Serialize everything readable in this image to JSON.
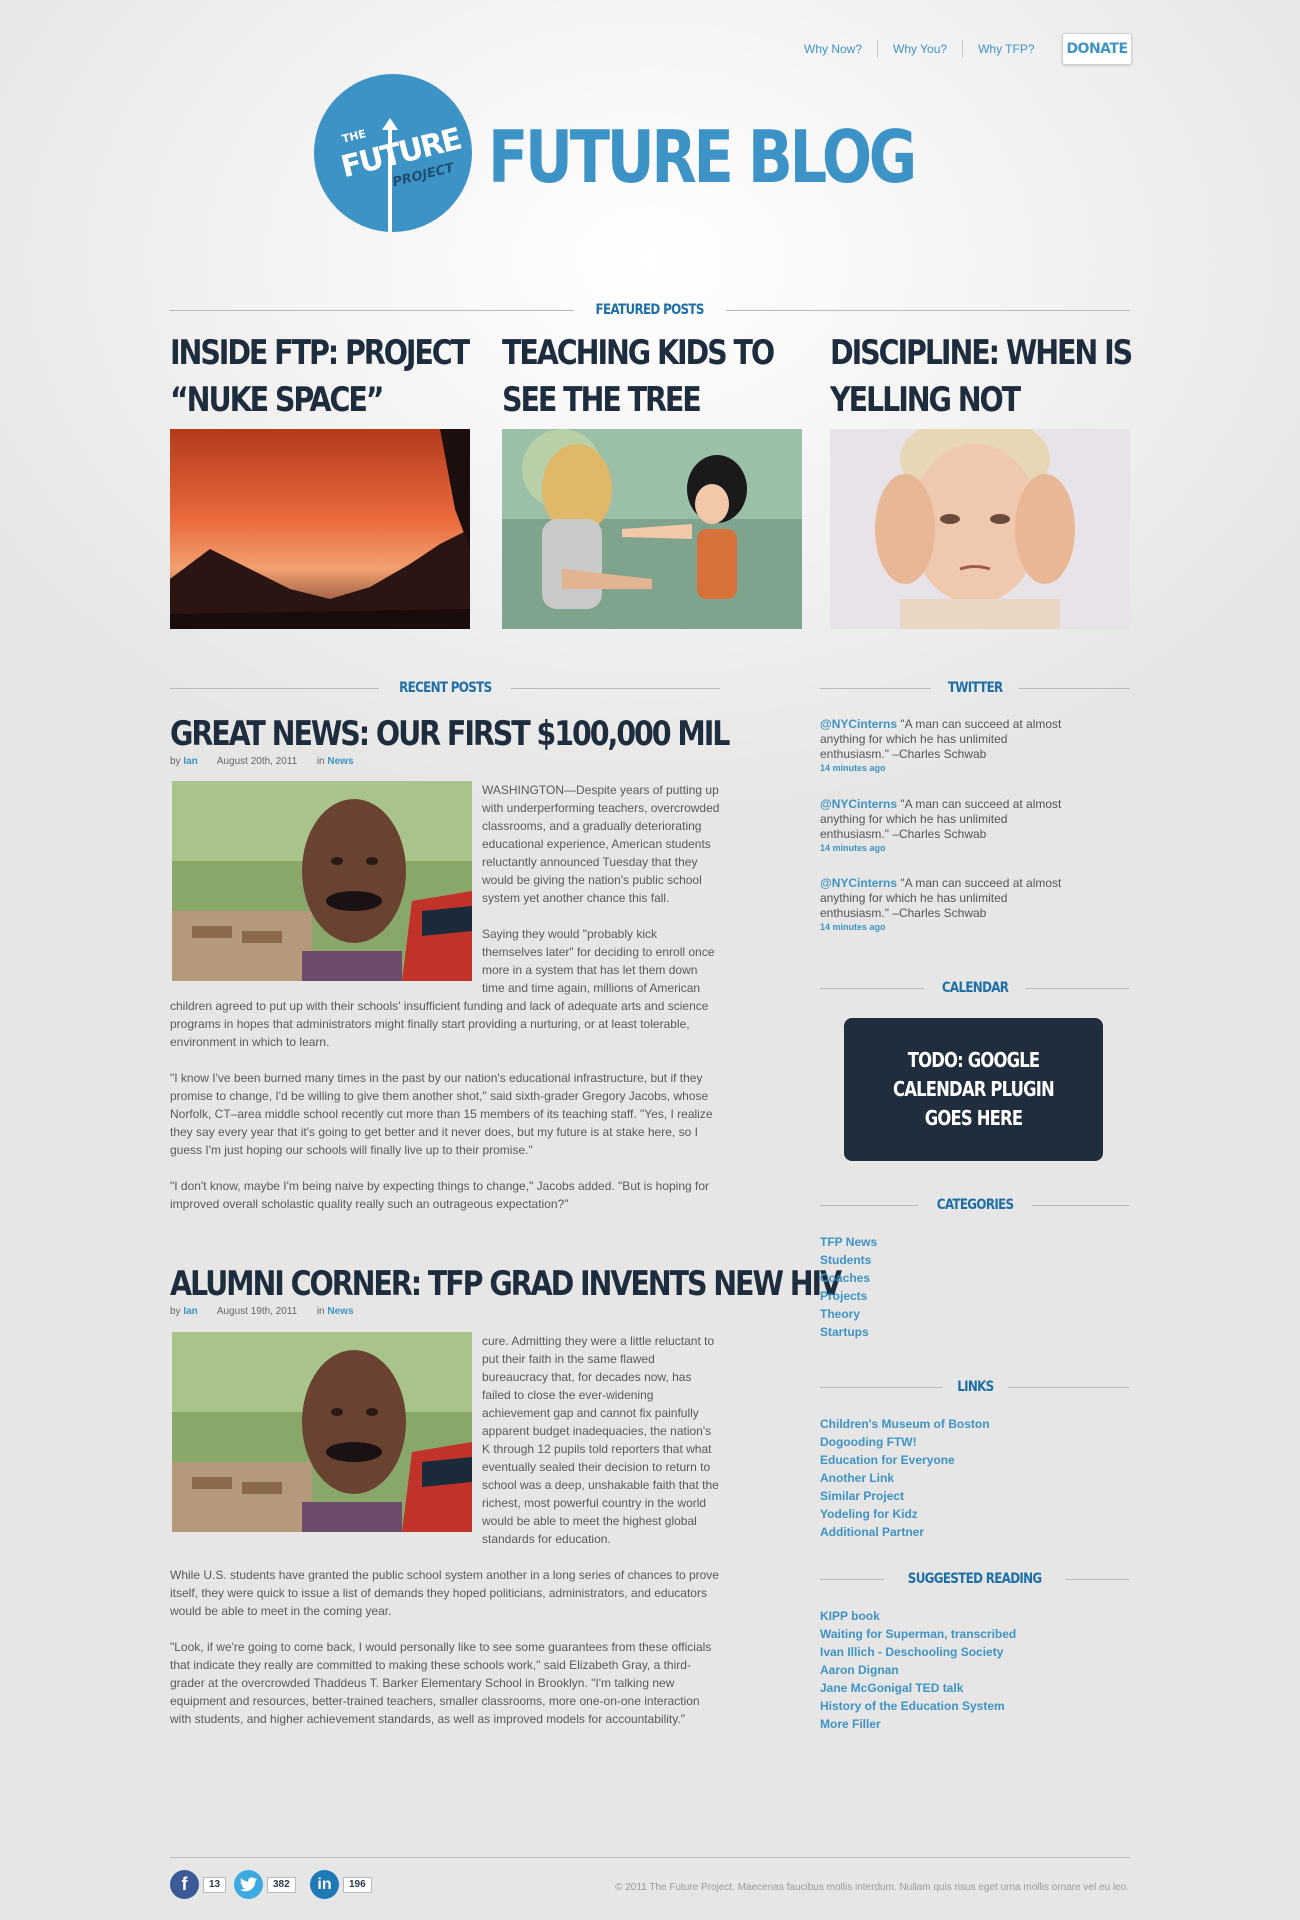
{
  "nav": {
    "links": [
      "Why Now?",
      "Why You?",
      "Why TFP?"
    ],
    "donate": "DONATE"
  },
  "logo": {
    "the": "THE",
    "future": "FUTURE",
    "project": "PROJECT"
  },
  "blog_title": "FUTURE BLOG",
  "featured": {
    "heading": "FEATURED POSTS",
    "posts": [
      {
        "title": "INSIDE FTP: PROJECT “NUKE SPACE”"
      },
      {
        "title": "TEACHING KIDS TO SEE THE TREE PEOPLE"
      },
      {
        "title": "DISCIPLINE: WHEN IS YELLING NOT ENOUGH?"
      }
    ]
  },
  "recent": {
    "heading": "RECENT POSTS",
    "posts": [
      {
        "title": "GREAT NEWS: OUR FIRST $100,000 MIL",
        "by": "by",
        "author": "Ian",
        "date": "August 20th, 2011",
        "in": "in",
        "category": "News",
        "p1": "WASHINGTON—Despite years of putting up with underperforming teachers, overcrowded classrooms, and a gradually deteriorating educational experience, American students reluctantly announced Tuesday that they would be giving the nation's public school system yet another chance this fall.",
        "p2": "Saying they would \"probably kick themselves later\" for deciding to enroll once more in a system that has let them down time and time again, millions of American children agreed to put up with their schools' insufficient funding and lack of adequate arts and science programs in hopes that administrators might finally start providing a nurturing, or at least tolerable, environment in which to learn.",
        "p3": "\"I know I've been burned many times in the past by our nation's educational infrastructure, but if they promise to change, I'd be willing to give them another shot,\" said sixth-grader Gregory Jacobs, whose Norfolk, CT–area middle school recently cut more than 15 members of its teaching staff. \"Yes, I realize they say every year that it's going to get better and it never does, but my future is at stake here, so I guess I'm just hoping our schools will finally live up to their promise.\"",
        "p4": "\"I don't know, maybe I'm being naive by expecting things to change,\" Jacobs added. \"But is hoping for improved overall scholastic quality really such an outrageous expectation?\""
      },
      {
        "title": "ALUMNI CORNER: TFP GRAD INVENTS NEW HIV",
        "by": "by",
        "author": "Ian",
        "date": "August 19th, 2011",
        "in": "in",
        "category": "News",
        "p1": "cure. Admitting they were a little reluctant to put their faith in the same flawed bureaucracy that, for decades now, has failed to close the ever-widening achievement gap and cannot fix painfully apparent budget inadequacies, the nation's K through 12 pupils told reporters that what eventually sealed their decision to return to school was a deep, unshakable faith that the richest, most powerful country in the world would be able to meet the highest global standards for education.",
        "p2": "While U.S. students have granted the public school system another in a long series of chances to prove itself, they were quick to issue a list of demands they hoped politicians, administrators, and educators would be able to meet in the coming year.",
        "p3": "\"Look, if we're going to come back, I would personally like to see some guarantees from these officials that indicate they really are committed to making these schools work,\" said Elizabeth Gray, a third-grader at the overcrowded Thaddeus T. Barker Elementary School in Brooklyn. \"I'm talking new equipment and resources, better-trained teachers, smaller classrooms, more one-on-one interaction with students, and higher achievement standards, as well as improved models for accountability.\""
      }
    ]
  },
  "twitter": {
    "heading": "TWITTER",
    "tweets": [
      {
        "handle": "@NYCinterns",
        "text": " \"A man can succeed at almost anything for which he has unlimited enthusiasm.\" –Charles Schwab",
        "time": "14 minutes ago"
      },
      {
        "handle": "@NYCinterns",
        "text": " \"A man can succeed at almost anything for which he has unlimited enthusiasm.\" –Charles Schwab",
        "time": "14 minutes ago"
      },
      {
        "handle": "@NYCinterns",
        "text": " \"A man can succeed at almost anything for which he has unlimited enthusiasm.\" –Charles Schwab",
        "time": "14 minutes ago"
      }
    ]
  },
  "calendar": {
    "heading": "CALENDAR",
    "placeholder": "TODO: GOOGLE CALENDAR PLUGIN GOES HERE"
  },
  "categories": {
    "heading": "CATEGORIES",
    "items": [
      "TFP News",
      "Students",
      "Coaches",
      "Projects",
      "Theory",
      "Startups"
    ]
  },
  "links": {
    "heading": "LINKS",
    "items": [
      "Children's Museum of Boston",
      "Dogooding FTW!",
      "Education for Everyone",
      "Another Link",
      "Similar Project",
      "Yodeling for Kidz",
      "Additional Partner"
    ]
  },
  "suggested": {
    "heading": "SUGGESTED READING",
    "items": [
      "KIPP book",
      "Waiting for Superman, transcribed",
      "Ivan Illich - Deschooling Society",
      "Aaron Dignan",
      "Jane McGonigal TED talk",
      "History of the Education System",
      "More Filler"
    ]
  },
  "footer": {
    "social": [
      {
        "icon": "f",
        "count": "13",
        "color": "#3b5b98"
      },
      {
        "icon": "t",
        "count": "382",
        "color": "#3ea9e0"
      },
      {
        "icon": "in",
        "count": "196",
        "color": "#1e79b5"
      }
    ],
    "copyright": "© 2011 The Future Project. Maecenas faucibus mollis interdum. Nullam quis risus eget urna mollis ornare vel eu leo."
  },
  "colors": {
    "accent": "#3d93c6",
    "heading_dark": "#1e2d3d",
    "calendar_bg": "#1f2d3d"
  }
}
